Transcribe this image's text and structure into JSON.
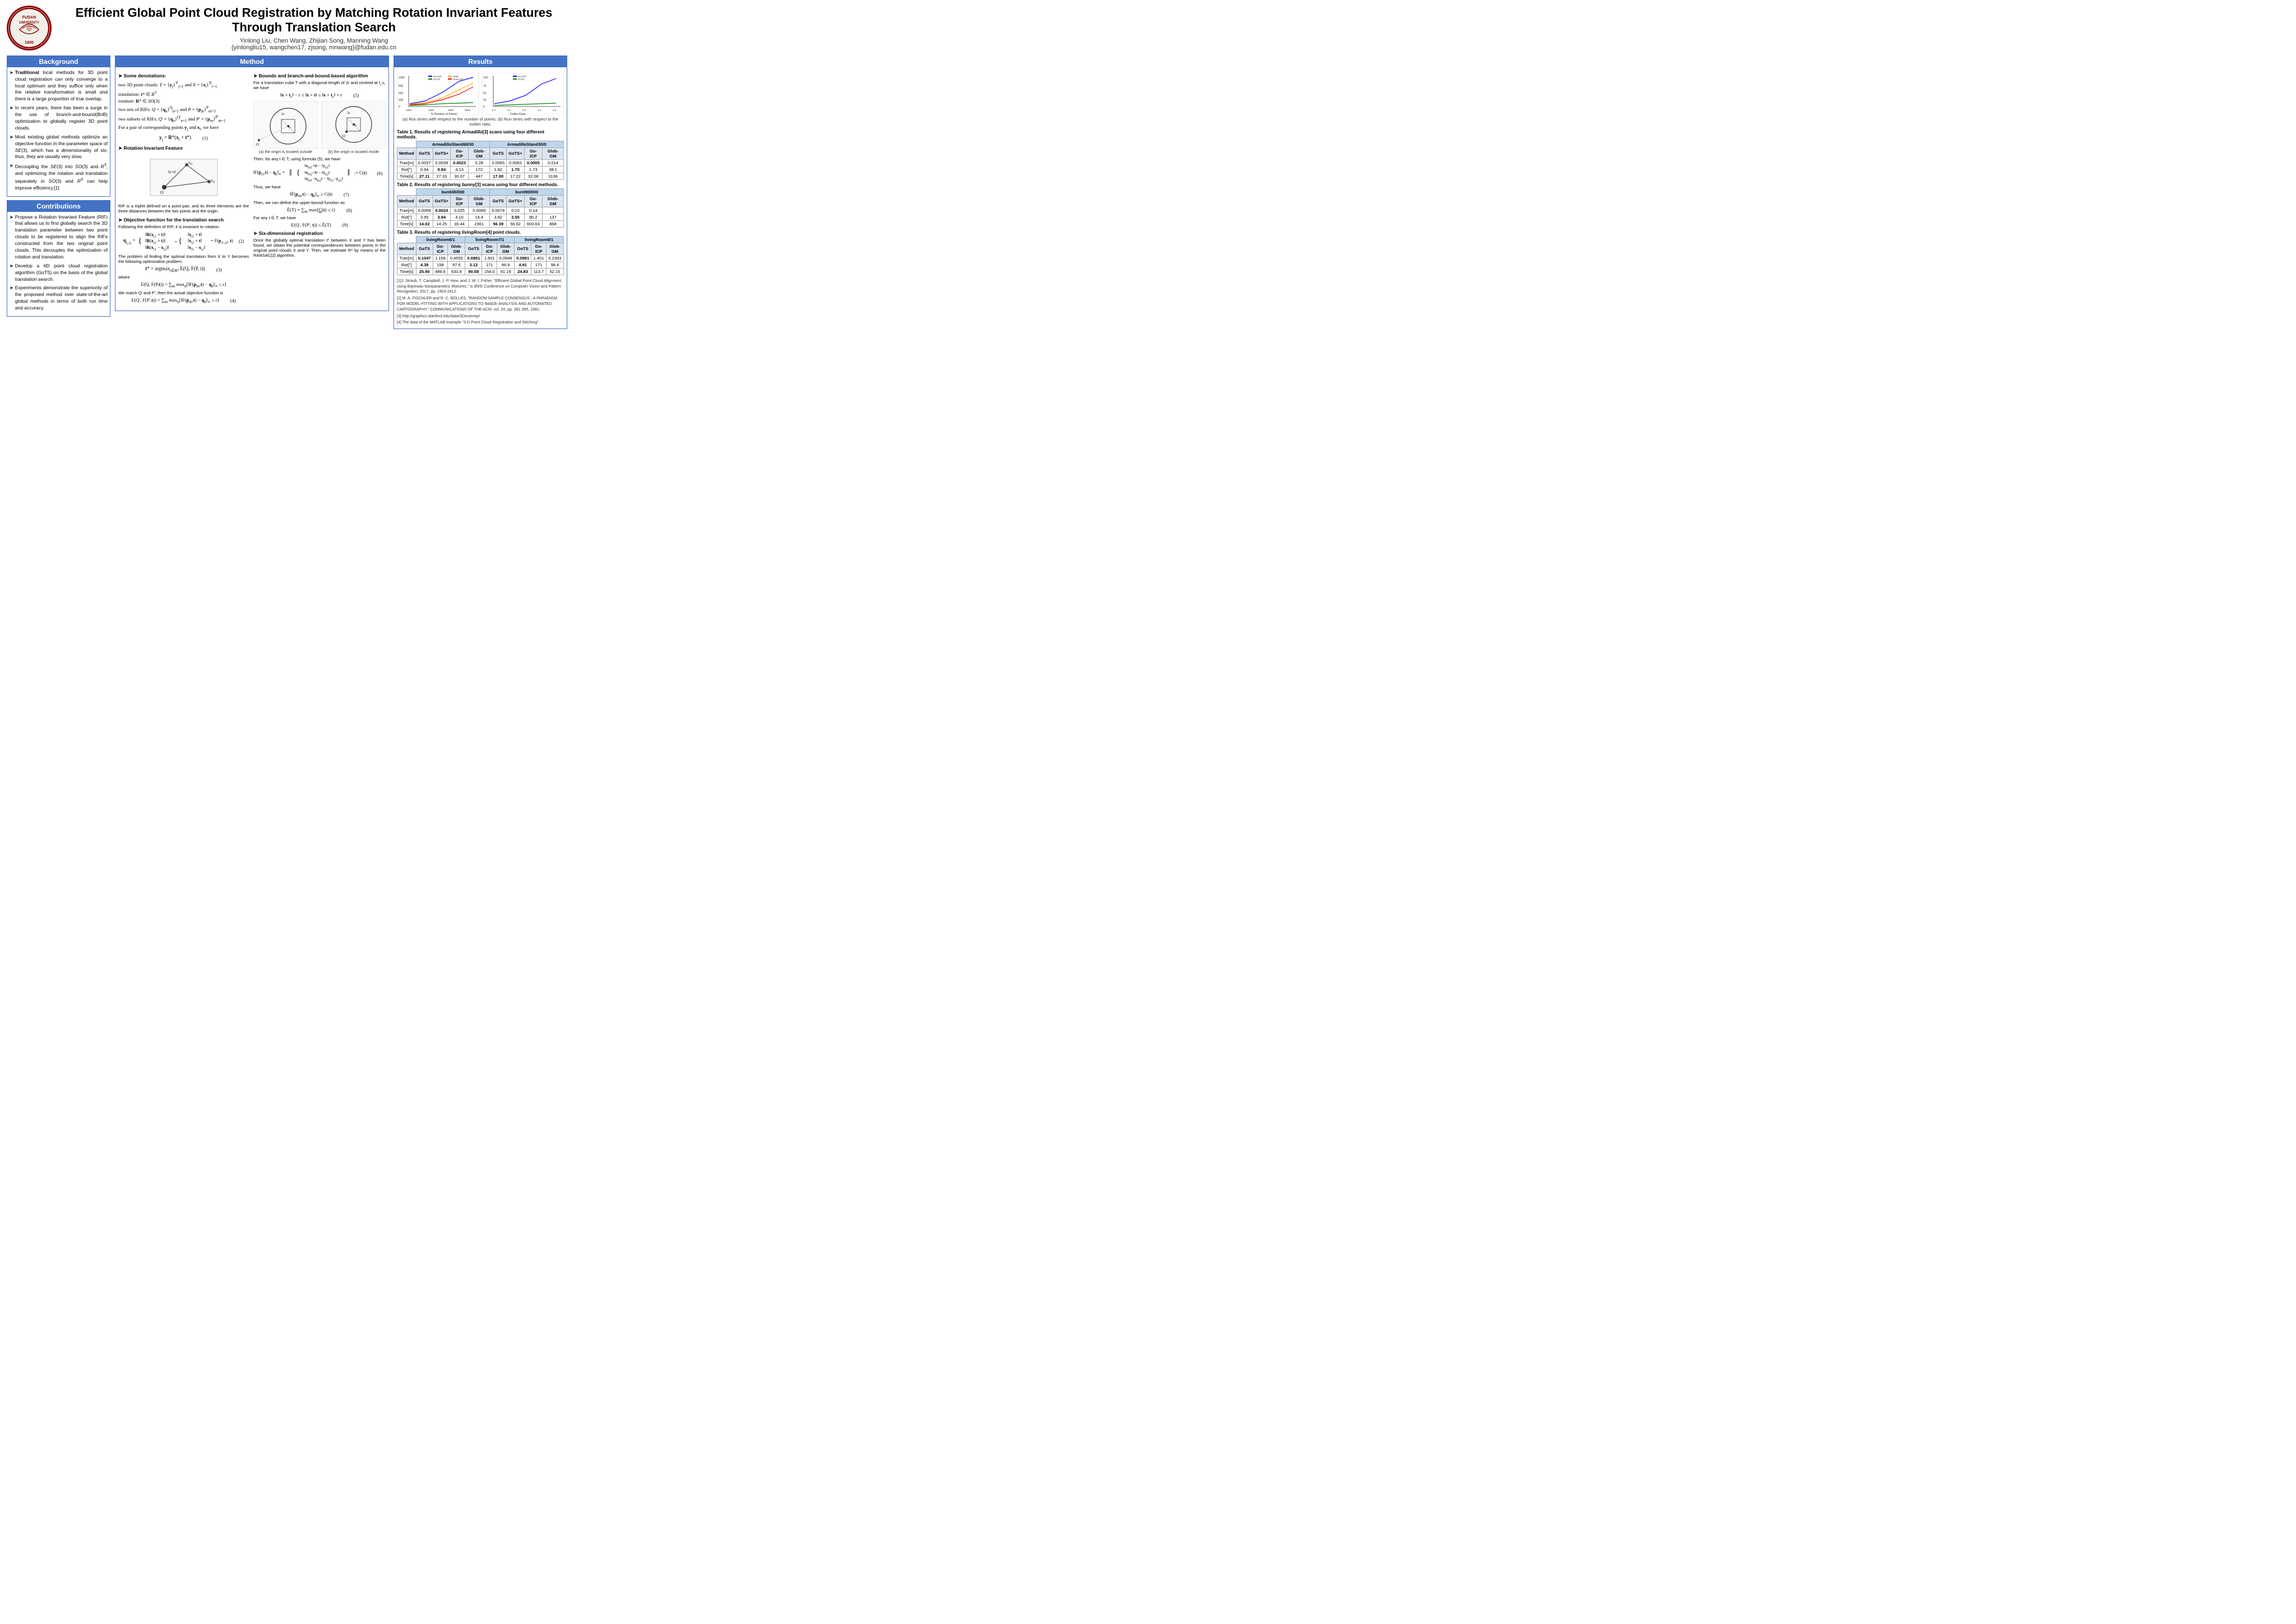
{
  "header": {
    "title_line1": "Efficient Global Point Cloud Registration  by Matching  Rotation Invariant Features",
    "title_line2": "Through Translation Search",
    "authors": "Yinlong Liu, Chen Wang, Zhijian Song, Manning Wang",
    "email": "{yinlongliu15, wangchen17, zjsong, mnwang}@fudan.edu.cn",
    "university": "FUDAN UNIVERSITY",
    "year": "1905"
  },
  "background": {
    "title": "Background",
    "bullets": [
      "Traditional local methods for 3D point cloud registration can only converge to a local optimum and they suffice only when the relative transformation is small and there is a large proportion of true overlap.",
      "In recent years, there has been a surge in the use of branch-and-bound(BnB) optimization to globally register 3D point clouds.",
      "Most existing global methods optimize an objective function in the parameter space of SE(3), which has a dimensionality of six; thus, they are usually very slow.",
      "Decoupling the SE(3) into SO(3) and R³, and optimizing the rotation and translation separately in SO(3) and R³ can help improve efficiency.[1]"
    ]
  },
  "contributions": {
    "title": "Contributions",
    "bullets": [
      "Propose a Rotation Invariant Feature (RIF) that allows us to first globally search the 3D translation parameter between two point clouds to be registered to align the RIFs constructed from the two original point clouds. This decouples the optimization of rotation and translation.",
      "Develop a 6D point cloud registration algorithm (GoTS) on the basis of the global translation search.",
      "Experiments demonstrate the superiority of the proposed method over state-of-the-art global methods in terms of both run time and accuracy."
    ]
  },
  "method": {
    "title": "Method",
    "denotations_title": "Some denotations:",
    "denotations": [
      "two 3D point clouds: Y = {y_j}^Y_{j=1} and X = {x_i}^X_{i=1}",
      "translation: t* ∈ R³",
      "rotation: R* ∈ SO(3)",
      "two sets of RIFs: Q = {q_n}^Q_{n=1} and P = {p_m}^P_{m=1}",
      "two subsets of RIFs: Q' = {q_n}^{Q'}_{n=1} and P' = {p_m}^{P'}_{m=1}",
      "For a pair of corresponding points y_j and x_i, we have"
    ],
    "eq1": "y_j = R*(x_i + t*)",
    "rif_title": "Rotation Invariant Feature",
    "rif_desc": "RIF is a triplet defined on a point pair, and its three elements are the three distances between the two points and the origin.",
    "obj_title": "Objective function for the translation search",
    "obj_desc": "Following the definition of RIF, it is invariant to rotation.",
    "eq2_lhs": "q_{j1,j2}",
    "bounds_title": "Bounds and branch-and-bound-based algorithm",
    "bounds_desc": "For a translation cube T with a diagonal length of 2r and centred at t_c, we have",
    "eq5": "‖x + t_c‖ - r ≤ ‖x + t‖ ≤ ‖x + t_c‖ + r",
    "fig_a_caption": "(a) the origin is located outside",
    "fig_b_caption": "(b) the origin is located inside",
    "eq6_desc": "Then, for any t ∈ T, using formula (5), we have",
    "eq7_desc": "Thus, we have",
    "eq8_desc": "Then, we can define the upper-bound function as",
    "eq9_desc": "For any t ∈ T, we have",
    "six_dim_title": "Six-dimensional registration",
    "six_dim_desc": "Once the globally optimal translation t* between X and Y has been found, we obtain the potential correspondences between points in the original point clouds X and Y. Then, we estimate R* by means of the RANSAC[2] algorithm."
  },
  "results": {
    "title": "Results",
    "chart_caption": "(a) Run times with respect to the number of points. (b) Run times with respect to the outlier ratio.",
    "table1_caption": "Table 1.  Results of registering Armadillo[3] scans using four different methods.",
    "table1": {
      "header_left": "ArmadilloStand60/30",
      "header_right": "ArmadilloStand30/0",
      "cols": [
        "Method",
        "GoTS",
        "GoTS+",
        "Go-ICP",
        "Glob-GM",
        "GoTS",
        "GoTS+",
        "Go-ICP",
        "Glob-GM"
      ],
      "rows": [
        [
          "Tran[m]",
          "0.0037",
          "0.0039",
          "0.0023",
          "0.28",
          "0.0065",
          "0.0063",
          "0.0005",
          "0.014"
        ],
        [
          "Rot[°]",
          "0.94",
          "0.84",
          "4.13",
          "172",
          "1.82",
          "1.70",
          "1.73",
          "38.1"
        ],
        [
          "Time[s]",
          "27.11",
          "27.33",
          "30.67",
          "447",
          "17.00",
          "17.22",
          "32.08",
          "3136"
        ]
      ]
    },
    "table2_caption": "Table 2.  Results of registering bunny[3] scans using four different methods.",
    "table2": {
      "header_left": "bun045/000",
      "header_right": "bun090/000",
      "cols": [
        "Method",
        "GoTS",
        "GoTS+",
        "Go-ICP",
        "Glob-GM",
        "GoTS",
        "GoTS+",
        "Go-ICP",
        "Glob-GM"
      ],
      "rows": [
        [
          "Tran[m]",
          "0.0058",
          "0.0024",
          "0.025",
          "0.0069",
          "0.0074",
          "0.10",
          "0.14",
          ""
        ],
        [
          "Rot[°]",
          "3.95",
          "3.94",
          "4.10",
          "19.4",
          "3.82",
          "3.55",
          "90.2",
          "137"
        ],
        [
          "Time[s]",
          "14.02",
          "14.25",
          "30.44",
          "2361",
          "56.39",
          "56.62",
          "603.63",
          "868"
        ]
      ]
    },
    "table3_caption": "Table 3.  Results of registering livingRoom[4] point clouds.",
    "table3": {
      "header_left1": "livingRoom6/1",
      "header_left2": "livingRoom7/1",
      "header_right": "livingRoom8/1",
      "cols": [
        "Method",
        "GoTS",
        "Go-ICP",
        "Glob-GM",
        "GoTS",
        "Go-ICP",
        "Glob-GM",
        "GoTS",
        "Go-ICP",
        "Glob-GM"
      ],
      "rows": [
        [
          "Tran[m]",
          "0.1047",
          "1.158",
          "0.4555",
          "0.0881",
          "1.601",
          "0.0949",
          "0.0981",
          "1.401",
          "0.2393"
        ],
        [
          "Rot[°]",
          "4.38",
          "158",
          "97.6",
          "3.12",
          "171",
          "96.9",
          "4.91",
          "171",
          "98.4"
        ],
        [
          "Time[s]",
          "25.90",
          "489.6",
          "633.8",
          "90.58",
          "154.0",
          "91.19",
          "24.83",
          "113.7",
          "52.15"
        ]
      ]
    },
    "references": [
      "[1]J. Straub, T. Campbell, J. P. How, and J. W. I. Fisher, \"Efficient Global Point Cloud Alignment using Bayesian Nonparametric Mixtures,\" in IEEE Conference on Computer Vision and Pattern Recognition, 2017, pp. 2403-2412.",
      "[2] M. A. FISCHLER and R. C. BOLLES, \"RANDOM SAMPLE CONSENSUS - A PARADIGM FOR MODEL-FITTING WITH APPLICATIONS TO IMAGE-ANALYSIS AND AUTOMATED CARTOGRAPHY,\" COMMUNICATIONS OF THE ACM, vol. 24, pp. 381-395, 1981.",
      "[3] http://graphics.stanford.edu/data/3Dscanrep/",
      "[4] The data of the MATLAB example \"3-D Point Cloud Registration and Stitching\"."
    ]
  }
}
